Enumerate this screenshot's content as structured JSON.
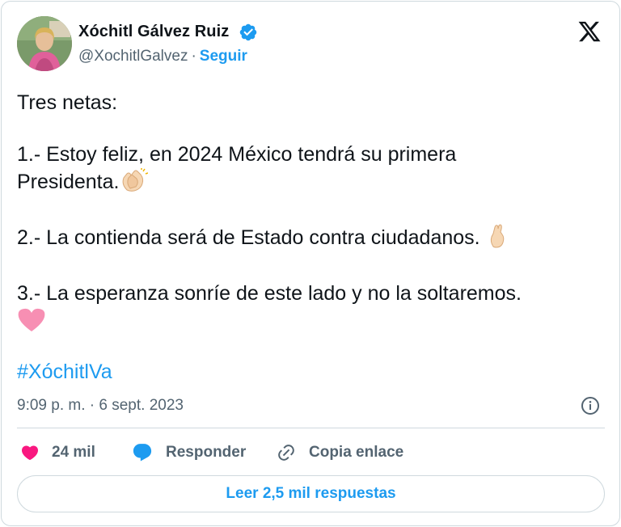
{
  "author": {
    "name": "Xóchitl Gálvez Ruiz",
    "handle": "@XochitlGalvez",
    "separator": "·",
    "follow_label": "Seguir"
  },
  "tweet": {
    "line_intro": "Tres netas:",
    "line_1": "1.- Estoy feliz, en 2024 México tendrá su primera",
    "line_1b": "Presidenta.",
    "line_2": "2.- La contienda será de Estado contra ciudadanos. ",
    "line_3": "3.- La esperanza sonríe de este lado y no la soltaremos.",
    "hashtag": "#XóchitlVa",
    "emojis": [
      "clapping-hands",
      "crossed-fingers",
      "pink-heart"
    ]
  },
  "meta": {
    "timestamp": "9:09 p. m. · 6 sept. 2023"
  },
  "actions": {
    "likes": "24 mil",
    "reply_label": "Responder",
    "copy_label": "Copia enlace",
    "read_replies_label": "Leer 2,5 mil respuestas"
  },
  "colors": {
    "accent": "#1d9bf0",
    "like": "#f91880",
    "muted": "#536471",
    "text": "#0f1419",
    "border": "#cfd9de"
  },
  "icons": [
    "verified-badge-icon",
    "x-logo-icon",
    "info-icon",
    "heart-icon",
    "reply-bubble-icon",
    "link-icon"
  ]
}
